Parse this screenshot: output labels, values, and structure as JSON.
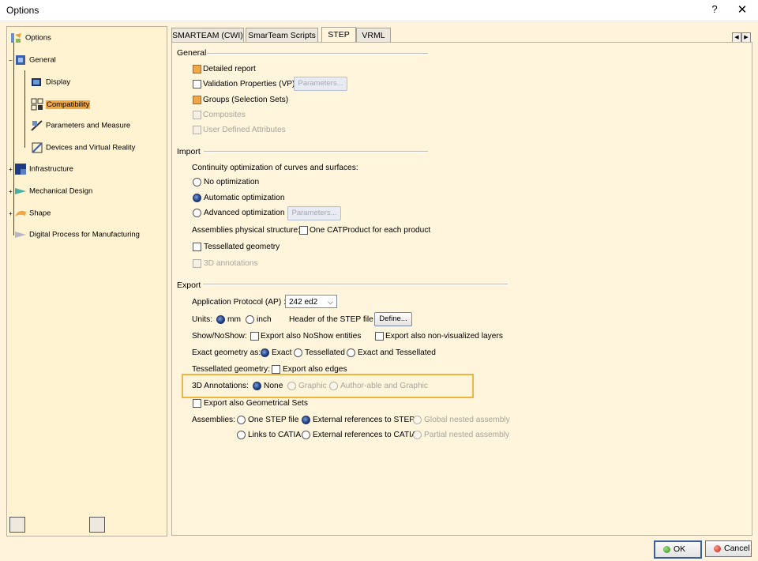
{
  "window": {
    "title": "Options",
    "help": "?",
    "close": "✕"
  },
  "tree": {
    "items": [
      {
        "label": "Options",
        "icon": "options-icon"
      },
      {
        "label": "General",
        "icon": "general-icon"
      },
      {
        "label": "Display",
        "icon": "display-icon"
      },
      {
        "label": "Compatibility",
        "icon": "compatibility-icon"
      },
      {
        "label": "Parameters and Measure",
        "icon": "parameters-icon"
      },
      {
        "label": "Devices and Virtual Reality",
        "icon": "devices-icon"
      },
      {
        "label": "Infrastructure",
        "icon": "infrastructure-icon"
      },
      {
        "label": "Mechanical Design",
        "icon": "mechanical-design-icon"
      },
      {
        "label": "Shape",
        "icon": "shape-icon"
      },
      {
        "label": "Digital Process for Manufacturing",
        "icon": "dpm-icon"
      }
    ]
  },
  "tabs": [
    "SMARTEAM (CWI)",
    "SmarTeam Scripts",
    "STEP",
    "VRML"
  ],
  "active_tab": "STEP",
  "general": {
    "title": "General",
    "detailed_report": "Detailed report",
    "validation_properties": "Validation Properties (VP)",
    "parameters_btn": "Parameters...",
    "groups": "Groups (Selection Sets)",
    "composites": "Composites",
    "user_defined": "User Defined Attributes"
  },
  "import": {
    "title": "Import",
    "continuity_label": "Continuity optimization of curves and surfaces:",
    "no_opt": "No optimization",
    "auto_opt": "Automatic optimization",
    "adv_opt": "Advanced optimization",
    "parameters_btn": "Parameters...",
    "assemblies_label": "Assemblies physical structure:",
    "one_catproduct": "One CATProduct for each product",
    "tessellated": "Tessellated geometry",
    "annotations_3d": "3D annotations"
  },
  "export": {
    "title": "Export",
    "ap_label": "Application Protocol (AP) :",
    "ap_value": "242 ed2",
    "units_label": "Units:",
    "mm": "mm",
    "inch": "inch",
    "header_label": "Header of the STEP file :",
    "define_btn": "Define...",
    "show_label": "Show/NoShow:",
    "noshow": "Export also NoShow entities",
    "nonvisual": "Export also non-visualized layers",
    "exact_label": "Exact geometry as:",
    "exact": "Exact",
    "tessellated": "Tessellated",
    "exact_tess": "Exact and Tessellated",
    "tess_geom_label": "Tessellated geometry:",
    "export_edges": "Export also edges",
    "annot_label": "3D Annotations:",
    "none": "None",
    "graphic": "Graphic",
    "authorable": "Author-able and Graphic",
    "geom_sets": "Export also Geometrical Sets",
    "assemblies_label": "Assemblies:",
    "one_step": "One STEP file",
    "ext_step": "External references to STEP",
    "global_nested": "Global nested assembly",
    "links_catia": "Links to CATIA",
    "ext_catia": "External references to CATIA",
    "partial_nested": "Partial nested assembly"
  },
  "footer": {
    "ok": "OK",
    "cancel": "Cancel"
  },
  "colors": {
    "accent_orange": "#f2b53b",
    "checked_box": "#f3a646",
    "panel_bg": "#fff4dc"
  }
}
